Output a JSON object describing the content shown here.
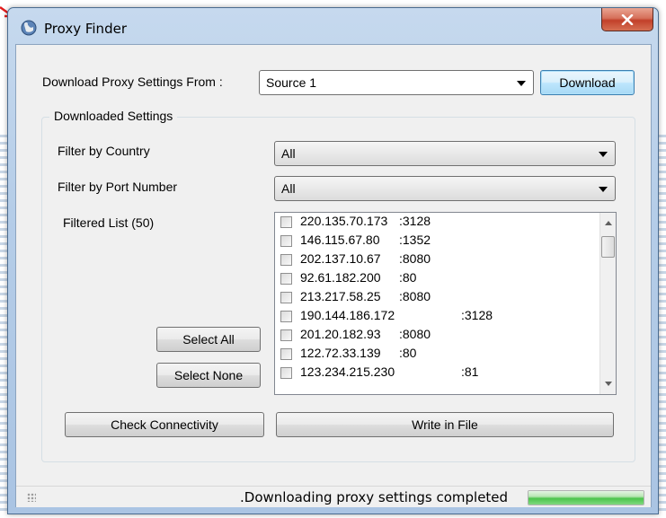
{
  "window": {
    "title": "Proxy Finder"
  },
  "download": {
    "label": "Download Proxy Settings From :",
    "source_value": "Source 1",
    "button_label": "Download"
  },
  "group": {
    "title": "Downloaded Settings",
    "country_label": "Filter by Country",
    "country_value": "All",
    "port_label": "Filter by Port Number",
    "port_value": "All",
    "list_label": "Filtered List (50)"
  },
  "list": {
    "items": [
      {
        "ip": "220.135.70.173",
        "port": ":3128"
      },
      {
        "ip": "146.115.67.80",
        "port": ":1352"
      },
      {
        "ip": "202.137.10.67",
        "port": ":8080"
      },
      {
        "ip": "92.61.182.200",
        "port": ":80"
      },
      {
        "ip": "213.217.58.25",
        "port": ":8080"
      },
      {
        "ip": "190.144.186.172",
        "port": ":3128"
      },
      {
        "ip": "201.20.182.93",
        "port": ":8080"
      },
      {
        "ip": "122.72.33.139",
        "port": ":80"
      },
      {
        "ip": "123.234.215.230",
        "port": ":81"
      }
    ]
  },
  "buttons": {
    "select_all": "Select  All",
    "select_none": "Select None",
    "check_connectivity": "Check Connectivity",
    "write_in_file": "Write in File"
  },
  "status": {
    "text": ".Downloading proxy settings completed",
    "progress_fraction": 1.0
  },
  "colors": {
    "title_gradient_top": "#c6d9ee",
    "close_button": "#c2402a",
    "default_button_border": "#3c7fb1",
    "progress_fill": "#4cc44c"
  }
}
